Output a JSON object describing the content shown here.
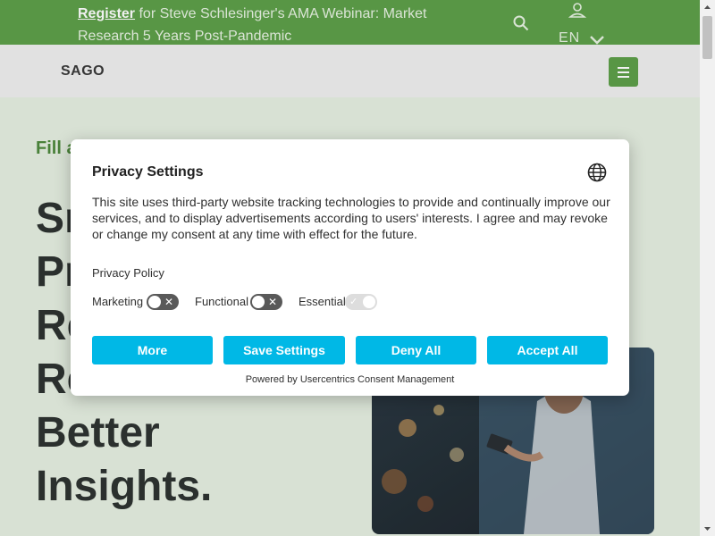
{
  "announcement": {
    "link_text": "Register",
    "text": " for Steve Schlesinger's AMA Webinar: Market Research 5 Years Post-Pandemic",
    "language": "EN"
  },
  "site": {
    "logo": "SAGO"
  },
  "hero": {
    "kicker": "Fill a",
    "title_lines": [
      "Sm",
      "Pr",
      "Re",
      "Re",
      "Better",
      "Insights."
    ]
  },
  "privacy_dialog": {
    "title": "Privacy Settings",
    "body": "This site uses third-party website tracking technologies to provide and continually improve our services, and to display advertisements according to users' interests. I agree and may revoke or change my consent at any time with effect for the future.",
    "policy_link": "Privacy Policy",
    "toggles": {
      "marketing": {
        "label": "Marketing",
        "enabled": false
      },
      "functional": {
        "label": "Functional",
        "enabled": false
      },
      "essential": {
        "label": "Essential",
        "enabled": true,
        "locked": true
      }
    },
    "buttons": {
      "more": "More",
      "save": "Save Settings",
      "deny": "Deny All",
      "accept": "Accept All"
    },
    "powered_by": "Powered by Usercentrics Consent Management"
  },
  "colors": {
    "brand_green": "#5ea04a",
    "button_blue": "#00b8e6"
  }
}
